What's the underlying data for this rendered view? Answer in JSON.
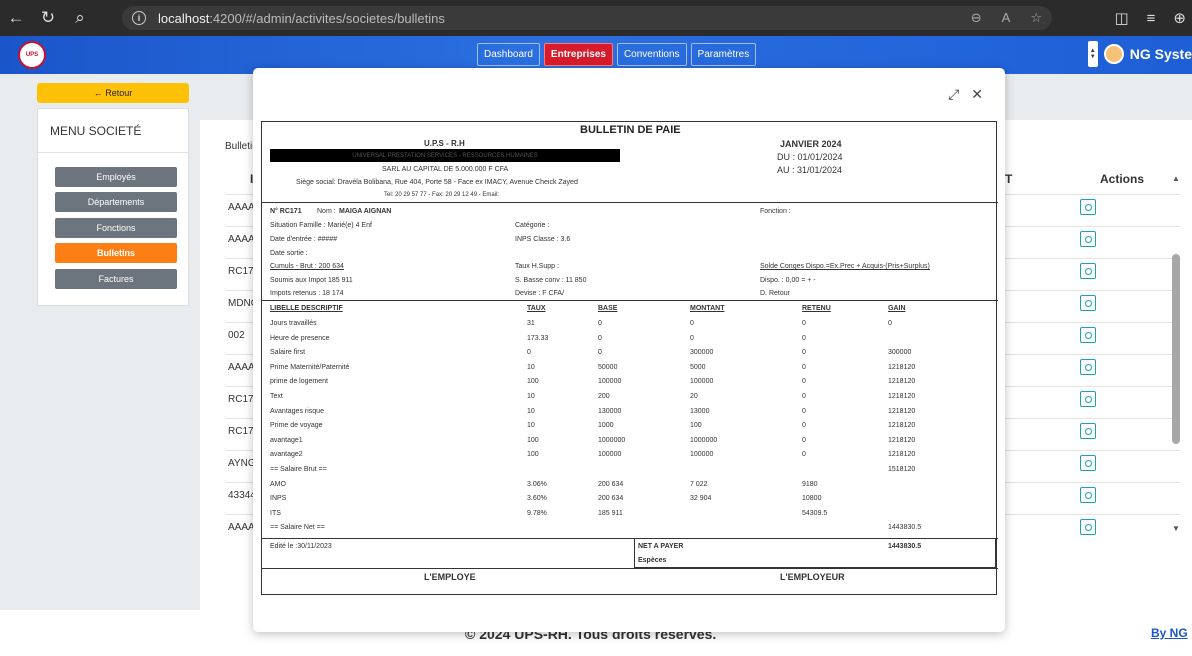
{
  "browser": {
    "url_host": "localhost",
    "url_path": ":4200/#/admin/activites/societes/bulletins"
  },
  "header": {
    "tabs": [
      "Dashboard",
      "Entreprises",
      "Conventions",
      "Paramètres"
    ],
    "active_tab": "Entreprises",
    "user_name": "NG Syste"
  },
  "sidebar": {
    "back_label": "← Retour",
    "menu_title": "MENU SOCIETÉ",
    "items": [
      "Employés",
      "Départements",
      "Fonctions",
      "Bulletins",
      "Factures"
    ],
    "active_item": "Bulletins"
  },
  "list": {
    "heading": "Bulletir",
    "col_first": "I",
    "col_mid": "T",
    "col_actions": "Actions",
    "rows": [
      "AAAA/",
      "AAAA/",
      "RC171",
      "MDNG",
      "002",
      "AAAA/",
      "RC17C",
      "RC17C",
      "AYNG!",
      "43344",
      "AAAA/"
    ]
  },
  "footer": {
    "copyright": "© 2024 UPS-RH. Tous droits réservés.",
    "link": "By NG"
  },
  "bulletin": {
    "title": "BULLETIN DE PAIE",
    "org_short": "U.P.S - R.H",
    "org_long": "UNIVERSAL PRESTATION SERVICES - RESSOURCES HUMAINES",
    "capital": "SARL AU CAPITAL DE 5.000.000 F CFA",
    "address": "Siège social: Dravéla Bolibana, Rue 404, Porte 58 - Face ex IMACY, Avenue Cheick Zayed",
    "contact": "Tel: 20 29 57 77 - Fax: 20 29 12 49 - Email:",
    "period": "JANVIER 2024",
    "du": "DU : 01/01/2024",
    "au": "AU : 31/01/2024",
    "matricule": "N° RC171",
    "nom_label": "Nom :",
    "nom": "MAIGA AIGNAN",
    "fonction": "Fonction :",
    "situation": "Situation Famille : Marié(e) 4 Enf",
    "categorie": "Catégorie :",
    "date_entree": "Date d'entrée : #####",
    "inps_classe": "INPS Classe : 3.6",
    "date_sortie": "Date sortie :",
    "cumuls": "Cumuls - Brut : 200 634",
    "taux_hsupp": "Taux H.Supp :",
    "solde_conges": "Solde Conges Dispo.=Ex.Prec + Acquis-(Pris+Surplus)",
    "soumis_impot": "Soumis aux Impot 185 911",
    "base_conv": "S. Basse conv : 11 850",
    "dispo": "Dispo. : 0,00 = + -",
    "impots_retenus": "Impots retenus : 18 174",
    "devise": "Devise : F CFA/",
    "d_retour": "D. Retour",
    "col_headers": [
      "LIBELLE DESCRIPTIF",
      "TAUX",
      "BASE",
      "MONTANT",
      "RETENU",
      "GAIN"
    ],
    "lines": [
      [
        "Jours travaillés",
        "31",
        "0",
        "0",
        "0",
        "0"
      ],
      [
        "Heure de presence",
        "173.33",
        "0",
        "0",
        "0",
        ""
      ],
      [
        "Salaire first",
        "0",
        "0",
        "300000",
        "0",
        "300000"
      ],
      [
        "Prime Maternité/Paternité",
        "10",
        "50000",
        "5000",
        "0",
        "1218120"
      ],
      [
        "prime de logement",
        "100",
        "100000",
        "100000",
        "0",
        "1218120"
      ],
      [
        "Text",
        "10",
        "200",
        "20",
        "0",
        "1218120"
      ],
      [
        "Avantages risque",
        "10",
        "130000",
        "13000",
        "0",
        "1218120"
      ],
      [
        "Prime de voyage",
        "10",
        "1000",
        "100",
        "0",
        "1218120"
      ],
      [
        "avantage1",
        "100",
        "1000000",
        "1000000",
        "0",
        "1218120"
      ],
      [
        "avantage2",
        "100",
        "100000",
        "100000",
        "0",
        "1218120"
      ],
      [
        "== Salaire Brut ==",
        "",
        "",
        "",
        "",
        "1518120"
      ],
      [
        "AMO",
        "3.06%",
        "200 634",
        "7 022",
        "9180",
        ""
      ],
      [
        "INPS",
        "3.60%",
        "200 634",
        "32 904",
        "10800",
        ""
      ],
      [
        "ITS",
        "9.78%",
        "185 911",
        "",
        "54309.5",
        ""
      ],
      [
        "== Salaire Net ==",
        "",
        "",
        "",
        "",
        "1443830.5"
      ]
    ],
    "edite_le": "Edité le :30/11/2023",
    "net_label": "NET A PAYER",
    "net_value": "1443830.5",
    "mode": "Espèces",
    "employe": "L'EMPLOYE",
    "employeur": "L'EMPLOYEUR"
  },
  "colors": {
    "header_blue": "#1a56c9",
    "active_red": "#d81b2a",
    "retour_yellow": "#ffc107",
    "active_orange": "#fd7e14",
    "menu_gray": "#6c757d",
    "action_teal": "#17a2b8"
  }
}
